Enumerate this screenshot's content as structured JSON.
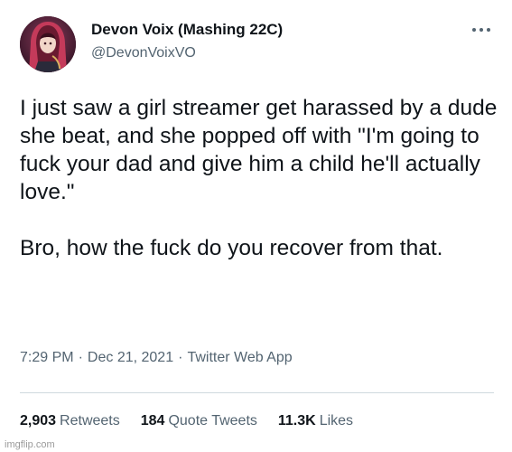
{
  "author": {
    "name": "Devon Voix (Mashing 22C)",
    "handle": "@DevonVoixVO",
    "avatar_icon": "profile-avatar"
  },
  "menu": {
    "icon": "more-options-icon"
  },
  "tweet": {
    "paragraphs": [
      "I just saw a girl streamer get harassed by a dude she beat, and she popped off with \"I'm going to fuck your dad and give him a child he'll actually love.\"",
      "Bro, how the fuck do you recover from that."
    ]
  },
  "meta": {
    "time": "7:29 PM",
    "separator": "·",
    "date": "Dec 21, 2021",
    "source": "Twitter Web App"
  },
  "stats": {
    "retweets_count": "2,903",
    "retweets_label": "Retweets",
    "quotes_count": "184",
    "quotes_label": "Quote Tweets",
    "likes_count": "11.3K",
    "likes_label": "Likes"
  },
  "watermark": "imgflip.com",
  "colors": {
    "text": "#0f1419",
    "secondary": "#536471",
    "divider": "#cfd9de",
    "background": "#ffffff"
  }
}
